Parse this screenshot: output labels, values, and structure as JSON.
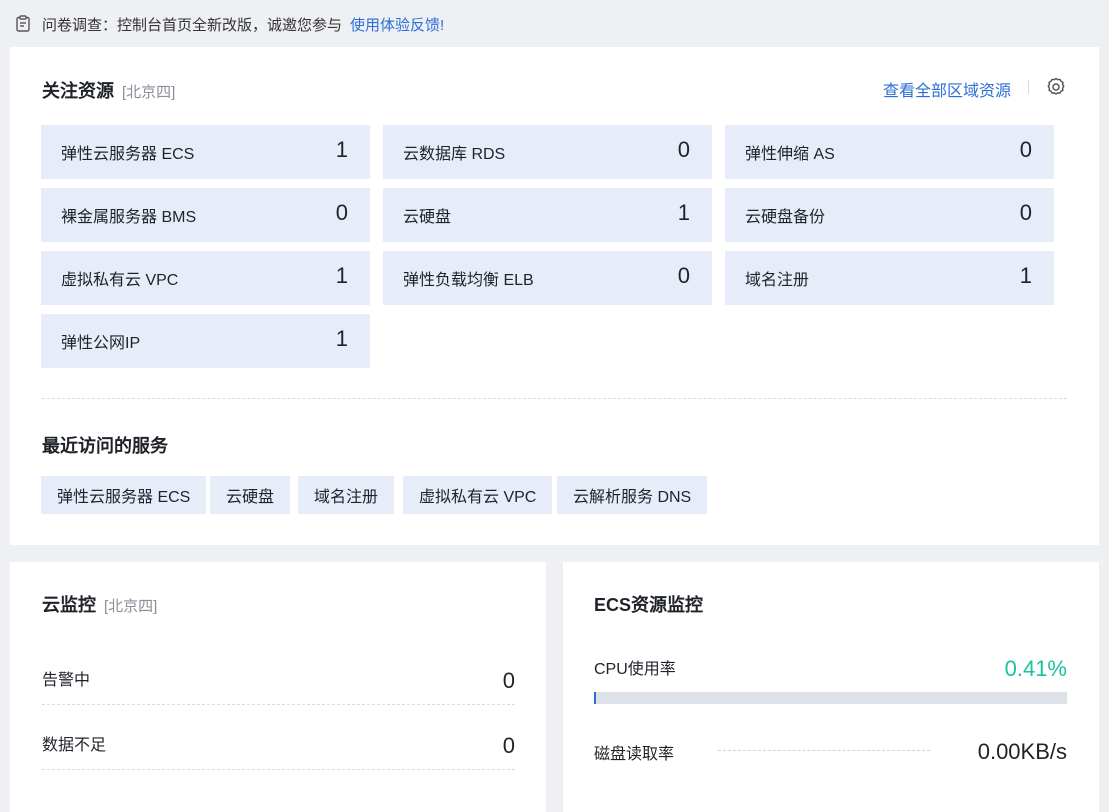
{
  "notice": {
    "text": "问卷调查：控制台首页全新改版，诚邀您参与",
    "link": "使用体验反馈!",
    "icon": "clipboard-icon"
  },
  "focus": {
    "title": "关注资源",
    "region": "[北京四]",
    "view_all": "查看全部区域资源",
    "settings_icon": "gear-icon",
    "tiles": [
      {
        "name": "弹性云服务器 ECS",
        "count": "1"
      },
      {
        "name": "云数据库 RDS",
        "count": "0"
      },
      {
        "name": "弹性伸缩 AS",
        "count": "0"
      },
      {
        "name": "裸金属服务器 BMS",
        "count": "0"
      },
      {
        "name": "云硬盘",
        "count": "1"
      },
      {
        "name": "云硬盘备份",
        "count": "0"
      },
      {
        "name": "虚拟私有云 VPC",
        "count": "1"
      },
      {
        "name": "弹性负载均衡 ELB",
        "count": "0"
      },
      {
        "name": "域名注册",
        "count": "1"
      },
      {
        "name": "弹性公网IP",
        "count": "1"
      }
    ]
  },
  "recent": {
    "title": "最近访问的服务",
    "items": [
      "弹性云服务器 ECS",
      "云硬盘",
      "域名注册",
      "虚拟私有云 VPC",
      "云解析服务 DNS"
    ]
  },
  "monitor": {
    "title": "云监控",
    "region": "[北京四]",
    "rows": [
      {
        "label": "告警中",
        "value": "0"
      },
      {
        "label": "数据不足",
        "value": "0"
      }
    ]
  },
  "ecs": {
    "title": "ECS资源监控",
    "cpu_label": "CPU使用率",
    "cpu_value": "0.41%",
    "cpu_fraction": 0.0041,
    "disk_label": "磁盘读取率",
    "disk_value": "0.00KB/s"
  },
  "colors": {
    "accent": "#2b6fd6",
    "tile_bg": "#e6edf8",
    "cpu_value": "#19c3a0"
  }
}
